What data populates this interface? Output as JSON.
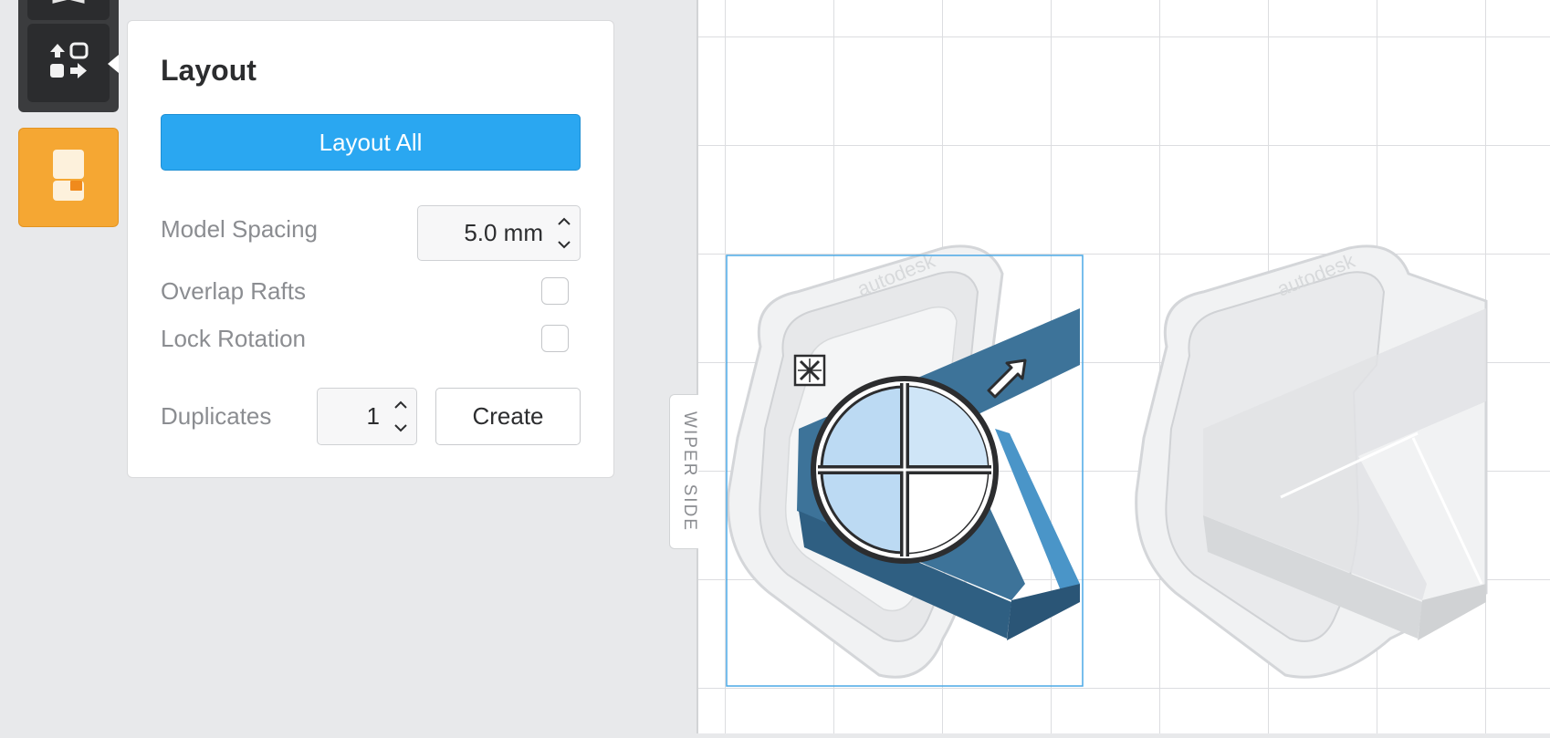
{
  "panel": {
    "title": "Layout",
    "layout_all_label": "Layout All",
    "model_spacing_label": "Model Spacing",
    "model_spacing_value": "5.0 mm",
    "overlap_rafts_label": "Overlap Rafts",
    "overlap_rafts_checked": false,
    "lock_rotation_label": "Lock Rotation",
    "lock_rotation_checked": false,
    "duplicates_label": "Duplicates",
    "duplicates_value": "1",
    "create_label": "Create"
  },
  "viewport": {
    "side_label": "WIPER SIDE",
    "model_engraving": "autodesk"
  },
  "icons": {
    "toolbar_top": "bookmark-icon",
    "layout_tool": "layout-arrange-icon",
    "supports_tool": "supports-icon",
    "move_handle": "move-icon",
    "scale_handle": "scale-arrow-icon",
    "gizmo": "rotation-gizmo-icon"
  },
  "colors": {
    "accent_blue": "#2aa7f1",
    "supports_orange": "#f5a733",
    "model_selected": "#3d7399",
    "toolbar_dark": "#2b2c2e"
  }
}
